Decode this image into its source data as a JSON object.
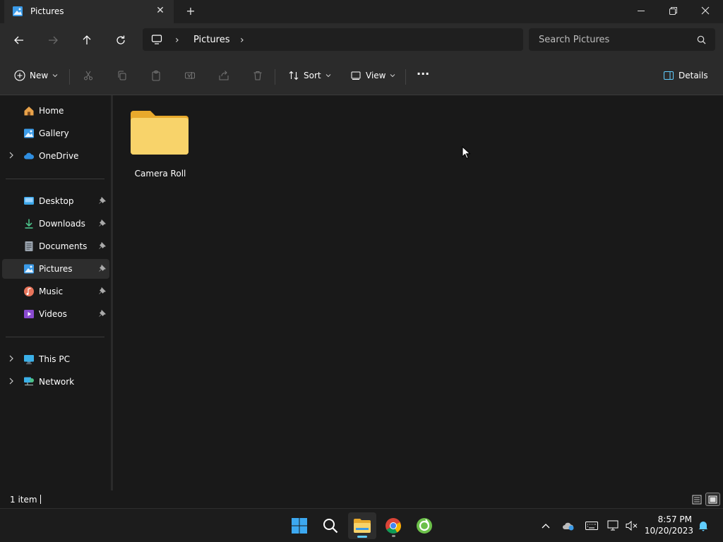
{
  "window": {
    "tab_title": "Pictures",
    "tab_close": "✕",
    "new_tab": "+"
  },
  "address": {
    "crumb": "Pictures",
    "separator": "›"
  },
  "search": {
    "placeholder": "Search Pictures"
  },
  "toolbar": {
    "new_label": "New",
    "sort_label": "Sort",
    "view_label": "View",
    "more_label": "···",
    "details_label": "Details"
  },
  "sidebar": {
    "items": [
      {
        "label": "Home"
      },
      {
        "label": "Gallery"
      },
      {
        "label": "OneDrive"
      },
      {
        "label": "Desktop"
      },
      {
        "label": "Downloads"
      },
      {
        "label": "Documents"
      },
      {
        "label": "Pictures"
      },
      {
        "label": "Music"
      },
      {
        "label": "Videos"
      },
      {
        "label": "This PC"
      },
      {
        "label": "Network"
      }
    ],
    "selected": "Pictures"
  },
  "content": {
    "items": [
      {
        "label": "Camera Roll",
        "icon": "folder-icon"
      }
    ]
  },
  "status": {
    "item_count": "1 item"
  },
  "taskbar": {
    "time": "8:57 PM",
    "date": "10/20/2023"
  },
  "colors": {
    "accent": "#60cdff",
    "folder": "#f8c84a",
    "selected_bg": "#2d2d2d"
  }
}
